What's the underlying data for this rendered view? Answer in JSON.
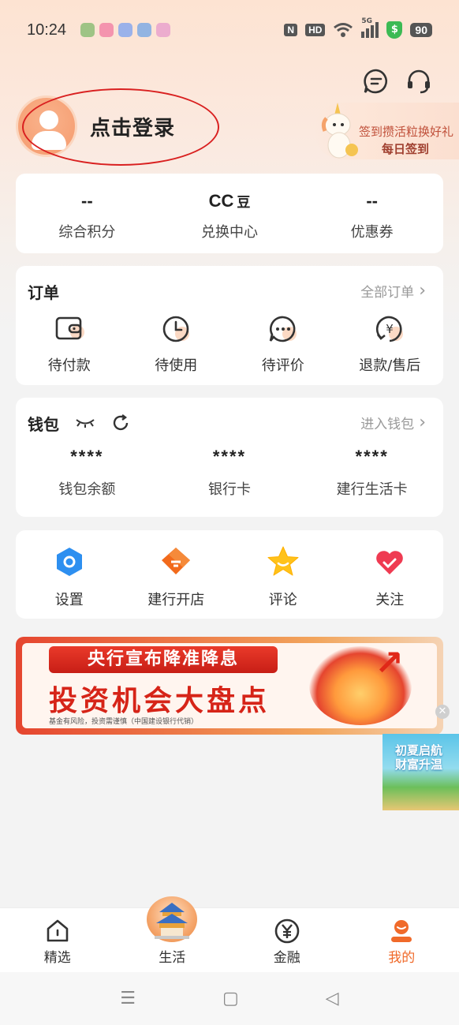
{
  "status_bar": {
    "time": "10:24",
    "nfc": "N",
    "hd": "HD",
    "network": "5G",
    "battery": "90"
  },
  "header": {
    "login_text": "点击登录",
    "message_icon": "message-icon",
    "service_icon": "headset-icon"
  },
  "signin": {
    "line1": "签到攒活粒换好礼",
    "line2": "每日签到"
  },
  "stats": [
    {
      "value": "--",
      "unit": "",
      "label": "综合积分"
    },
    {
      "value": "CC",
      "unit": "豆",
      "label": "兑换中心"
    },
    {
      "value": "--",
      "unit": "",
      "label": "优惠券"
    }
  ],
  "orders": {
    "title": "订单",
    "link": "全部订单",
    "items": [
      {
        "label": "待付款",
        "icon": "wallet-icon"
      },
      {
        "label": "待使用",
        "icon": "clock-icon"
      },
      {
        "label": "待评价",
        "icon": "chat-dots-icon"
      },
      {
        "label": "退款/售后",
        "icon": "refund-icon"
      }
    ]
  },
  "wallet": {
    "title": "钱包",
    "link": "进入钱包",
    "items": [
      {
        "value": "****",
        "label": "钱包余额"
      },
      {
        "value": "****",
        "label": "银行卡"
      },
      {
        "value": "****",
        "label": "建行生活卡"
      }
    ]
  },
  "tools": [
    {
      "label": "设置",
      "icon": "settings-icon"
    },
    {
      "label": "建行开店",
      "icon": "shop-icon"
    },
    {
      "label": "评论",
      "icon": "star-icon"
    },
    {
      "label": "关注",
      "icon": "heart-icon"
    }
  ],
  "banner": {
    "headline": "央行宣布降准降息",
    "title": "投资机会大盘点",
    "note": "基金有风险，投资需谨慎（中国建设银行代销）"
  },
  "float_ad": {
    "text": "初夏启航 财富升温"
  },
  "tabbar": [
    {
      "label": "精选",
      "icon": "home-icon",
      "active": false
    },
    {
      "label": "生活",
      "icon": "temple-icon",
      "active": false
    },
    {
      "label": "金融",
      "icon": "yen-icon",
      "active": false
    },
    {
      "label": "我的",
      "icon": "profile-icon",
      "active": true
    }
  ],
  "colors": {
    "accent": "#f06a2a",
    "banner_red": "#d62418",
    "annotation_red": "#d92020"
  }
}
